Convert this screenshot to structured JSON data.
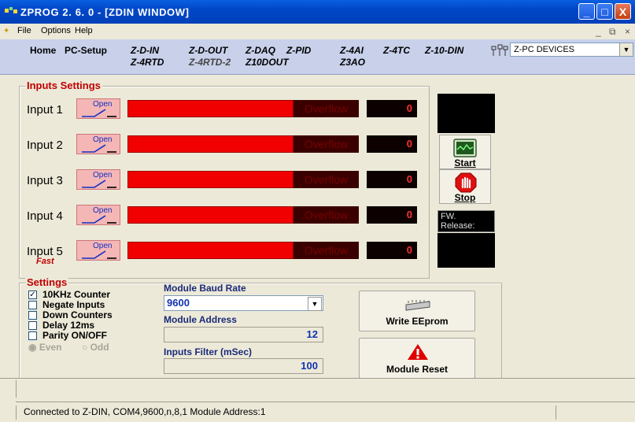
{
  "window": {
    "title": "ZPROG  2. 6. 0 - [ZDIN  WINDOW]",
    "minimize": "_",
    "maximize": "□",
    "close": "X"
  },
  "menu": {
    "items": [
      "File",
      "Options",
      "Help"
    ],
    "mdi_min": "_",
    "mdi_restore": "⧉",
    "mdi_close": "×"
  },
  "toolbar": {
    "home": "Home",
    "pc_setup": "PC-Setup",
    "zdin": "Z-D-IN",
    "z4rtd": "Z-4RTD",
    "zdout": "Z-D-OUT",
    "z4rtd2": "Z-4RTD-2",
    "zdaq": "Z-DAQ",
    "z10dout": "Z10DOUT",
    "zpid": "Z-PID",
    "z4ai": "Z-4AI",
    "z3ao": "Z3AO",
    "z4tc": "Z-4TC",
    "z10din": "Z-10-DIN",
    "device_select": "Z-PC DEVICES"
  },
  "inputs": {
    "title": "Inputs Settings",
    "open_label": "Open",
    "overflow_label": "Overflow",
    "fast_label": "Fast",
    "rows": [
      {
        "label": "Input 1",
        "count": "0"
      },
      {
        "label": "Input 2",
        "count": "0"
      },
      {
        "label": "Input 3",
        "count": "0"
      },
      {
        "label": "Input 4",
        "count": "0"
      },
      {
        "label": "Input 5",
        "count": "0"
      }
    ]
  },
  "side": {
    "start": "Start",
    "stop": "Stop",
    "fw": "FW.",
    "release": "Release:"
  },
  "settings": {
    "title": "Settings",
    "checkboxes": [
      {
        "label": "10KHz Counter",
        "checked": true
      },
      {
        "label": "Negate Inputs",
        "checked": false
      },
      {
        "label": "Down Counters",
        "checked": false
      },
      {
        "label": "Delay 12ms",
        "checked": false
      },
      {
        "label": "Parity ON/OFF",
        "checked": false
      }
    ],
    "even": "Even",
    "odd": "Odd",
    "baud_label": "Module Baud Rate",
    "baud_value": "9600",
    "address_label": "Module Address",
    "address_value": "12",
    "filter_label": "Inputs Filter (mSec)",
    "filter_value": "100",
    "write_eeprom": "Write EEprom",
    "module_reset": "Module Reset"
  },
  "status": {
    "text": "Connected to Z-DIN, COM4,9600,n,8,1  Module Address:1"
  }
}
